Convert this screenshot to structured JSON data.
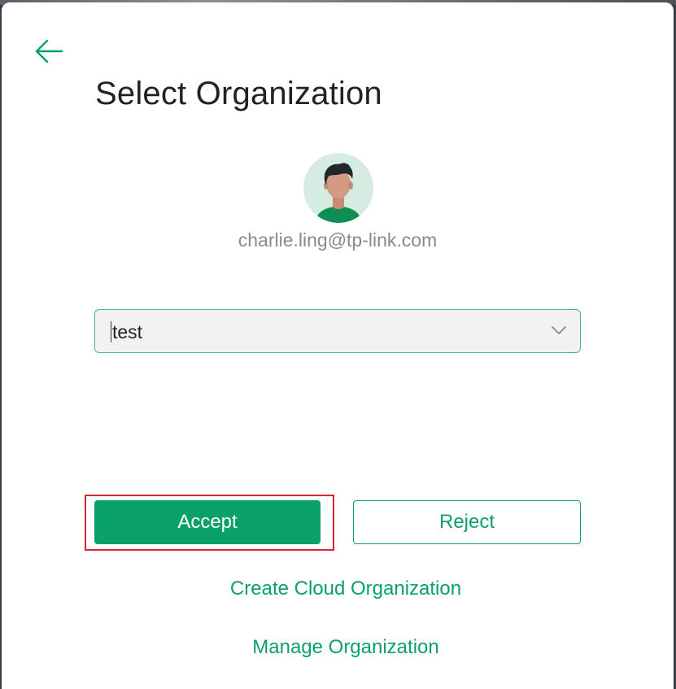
{
  "dialog": {
    "title": "Select Organization",
    "back_icon": "arrow-left-icon"
  },
  "user": {
    "avatar_icon": "user-avatar-icon",
    "email": "charlie.ling@tp-link.com"
  },
  "organization_select": {
    "value": "test",
    "dropdown_icon": "chevron-down-icon"
  },
  "actions": {
    "accept_label": "Accept",
    "reject_label": "Reject"
  },
  "links": {
    "create": "Create Cloud Organization",
    "manage": "Manage Organization"
  },
  "colors": {
    "brand_green": "#0aa06a",
    "select_border": "#46b884",
    "highlight_red": "#d6262f"
  }
}
